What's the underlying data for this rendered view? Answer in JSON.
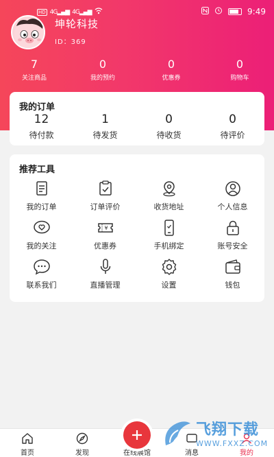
{
  "status_bar": {
    "hd": "HD",
    "net1": "4G",
    "net2": "4G",
    "time": "9:49"
  },
  "profile": {
    "company_name": "坤轮科技",
    "user_id": "ID：369"
  },
  "stats": [
    {
      "value": "7",
      "label": "关注商品"
    },
    {
      "value": "0",
      "label": "我的预约"
    },
    {
      "value": "0",
      "label": "优惠券"
    },
    {
      "value": "0",
      "label": "购物车"
    }
  ],
  "orders": {
    "title": "我的订单",
    "items": [
      {
        "count": "12",
        "label": "待付款"
      },
      {
        "count": "1",
        "label": "待发货"
      },
      {
        "count": "0",
        "label": "待收货"
      },
      {
        "count": "0",
        "label": "待评价"
      }
    ]
  },
  "tools": {
    "title": "推荐工具",
    "items": [
      {
        "label": "我的订单",
        "icon": "order-list-icon"
      },
      {
        "label": "订单评价",
        "icon": "clipboard-check-icon"
      },
      {
        "label": "收货地址",
        "icon": "location-pin-icon"
      },
      {
        "label": "个人信息",
        "icon": "user-circle-icon"
      },
      {
        "label": "我的关注",
        "icon": "heart-bubble-icon"
      },
      {
        "label": "优惠券",
        "icon": "coupon-icon"
      },
      {
        "label": "手机绑定",
        "icon": "phone-icon"
      },
      {
        "label": "账号安全",
        "icon": "lock-icon"
      },
      {
        "label": "联系我们",
        "icon": "chat-bubble-icon"
      },
      {
        "label": "直播管理",
        "icon": "microphone-icon"
      },
      {
        "label": "设置",
        "icon": "gear-icon"
      },
      {
        "label": "钱包",
        "icon": "wallet-icon"
      }
    ]
  },
  "tabbar": {
    "home": "首页",
    "discover": "发现",
    "center": "在线展馆",
    "messages": "消息",
    "mine": "我的"
  },
  "watermark": {
    "cn": "飞翔下载",
    "en": "WWW.FXXZ.COM"
  },
  "colors": {
    "header_start": "#f5465a",
    "header_end": "#ec1f77",
    "accent_red": "#e8363c",
    "watermark_blue": "#3a8fd8"
  }
}
